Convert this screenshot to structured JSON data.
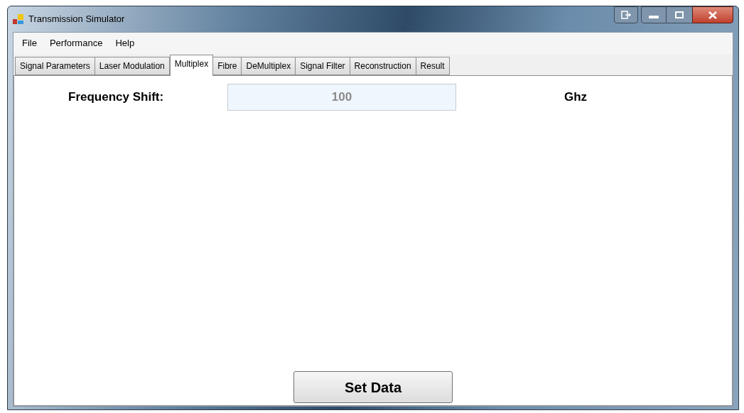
{
  "window": {
    "title": "Transmission Simulator"
  },
  "menu": [
    "File",
    "Performance",
    "Help"
  ],
  "tabs": [
    {
      "label": "Signal Parameters",
      "selected": false
    },
    {
      "label": "Laser Modulation",
      "selected": false
    },
    {
      "label": "Multiplex",
      "selected": true
    },
    {
      "label": "Fibre",
      "selected": false
    },
    {
      "label": "DeMultiplex",
      "selected": false
    },
    {
      "label": "Signal Filter",
      "selected": false
    },
    {
      "label": "Reconstruction",
      "selected": false
    },
    {
      "label": "Result",
      "selected": false
    }
  ],
  "form": {
    "label": "Frequency Shift:",
    "value": "100",
    "disabled": true,
    "unit": "Ghz"
  },
  "buttons": [
    "Set Data"
  ]
}
